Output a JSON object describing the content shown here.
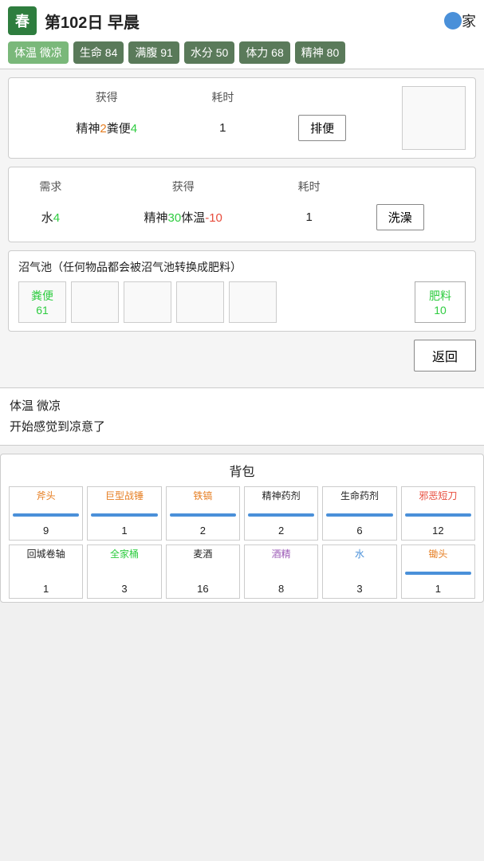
{
  "topBar": {
    "season": "春",
    "dayLabel": "第102日 早晨",
    "homeLabel": "家",
    "stats": [
      {
        "label": "体温 微凉",
        "active": true
      },
      {
        "label": "生命 84",
        "active": false
      },
      {
        "label": "满腹 91",
        "active": false
      },
      {
        "label": "水分 50",
        "active": false
      },
      {
        "label": "体力 68",
        "active": false
      },
      {
        "label": "精神 80",
        "active": false
      }
    ]
  },
  "actionCard1": {
    "headers": [
      "获得",
      "耗时"
    ],
    "gainText_static": "精神2粪便4",
    "gainParts": [
      {
        "text": "精神",
        "color": "normal"
      },
      {
        "text": "2",
        "color": "orange"
      },
      {
        "text": "粪便",
        "color": "normal"
      },
      {
        "text": "4",
        "color": "green"
      }
    ],
    "time": "1",
    "buttonLabel": "排便"
  },
  "actionCard2": {
    "headers": [
      "需求",
      "获得",
      "耗时"
    ],
    "needParts": [
      {
        "text": "水",
        "color": "normal"
      },
      {
        "text": "4",
        "color": "green"
      }
    ],
    "gainParts": [
      {
        "text": "精神",
        "color": "normal"
      },
      {
        "text": "30",
        "color": "green"
      },
      {
        "text": "体温",
        "color": "normal"
      },
      {
        "text": "-10",
        "color": "red"
      }
    ],
    "time": "1",
    "buttonLabel": "洗澡"
  },
  "biogasCard": {
    "title": "沼气池（任何物品都会被沼气池转换成肥料）",
    "slots": [
      {
        "name": "粪便",
        "qty": "61",
        "filled": true
      },
      {
        "name": "",
        "qty": "",
        "filled": false
      },
      {
        "name": "",
        "qty": "",
        "filled": false
      },
      {
        "name": "",
        "qty": "",
        "filled": false
      },
      {
        "name": "",
        "qty": "",
        "filled": false
      }
    ],
    "output": {
      "name": "肥料",
      "qty": "10"
    }
  },
  "returnButton": "返回",
  "statusText": {
    "line1": "体温 微凉",
    "line2": "开始感觉到凉意了"
  },
  "backpack": {
    "title": "背包",
    "items": [
      {
        "name": "斧头",
        "qty": "9",
        "color": "orange",
        "bar": true
      },
      {
        "name": "巨型战锤",
        "qty": "1",
        "color": "orange",
        "bar": true
      },
      {
        "name": "铁镐",
        "qty": "2",
        "color": "orange",
        "bar": true
      },
      {
        "name": "精神药剂",
        "qty": "2",
        "color": "normal",
        "bar": true
      },
      {
        "name": "生命药剂",
        "qty": "6",
        "color": "normal",
        "bar": true
      },
      {
        "name": "邪恶短刀",
        "qty": "12",
        "color": "red",
        "bar": true
      },
      {
        "name": "回城卷轴",
        "qty": "1",
        "color": "normal",
        "bar": false
      },
      {
        "name": "全家桶",
        "qty": "3",
        "color": "green",
        "bar": false
      },
      {
        "name": "麦酒",
        "qty": "16",
        "color": "normal",
        "bar": false
      },
      {
        "name": "酒精",
        "qty": "8",
        "color": "purple",
        "bar": false
      },
      {
        "name": "水",
        "qty": "3",
        "color": "blue",
        "bar": false
      },
      {
        "name": "锄头",
        "qty": "1",
        "color": "orange",
        "bar": true
      }
    ]
  }
}
